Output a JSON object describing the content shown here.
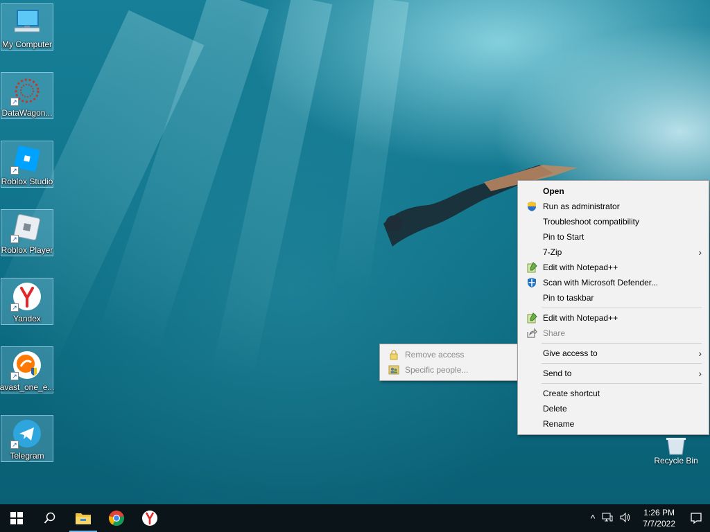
{
  "desktop": {
    "icons": [
      {
        "label": "My Computer",
        "icon": "computer-icon"
      },
      {
        "label": "DataWagon...",
        "icon": "datawagon-icon"
      },
      {
        "label": "Roblox Studio",
        "icon": "roblox-studio-icon"
      },
      {
        "label": "Roblox Player",
        "icon": "roblox-player-icon"
      },
      {
        "label": "Yandex",
        "icon": "yandex-icon"
      },
      {
        "label": "avast_one_e...",
        "icon": "avast-icon"
      },
      {
        "label": "Telegram",
        "icon": "telegram-icon"
      }
    ],
    "recycle_bin": {
      "label": "Recycle Bin",
      "icon": "recycle-bin-icon"
    }
  },
  "context_menu": {
    "items": [
      {
        "label": "Open"
      },
      {
        "label": "Run as administrator",
        "icon": "uac-shield-icon"
      },
      {
        "label": "Troubleshoot compatibility"
      },
      {
        "label": "Pin to Start"
      },
      {
        "label": "7-Zip",
        "submenu_arrow": "›"
      },
      {
        "label": "Edit with Notepad++",
        "icon": "notepad-plus-plus-icon"
      },
      {
        "label": "Scan with Microsoft Defender...",
        "icon": "defender-icon"
      },
      {
        "label": "Pin to taskbar"
      },
      {
        "label": "Edit with Notepad++",
        "icon": "notepad-plus-plus-icon"
      },
      {
        "label": "Share",
        "icon": "share-icon"
      },
      {
        "label": "Give access to",
        "submenu_arrow": "›"
      },
      {
        "label": "Send to",
        "submenu_arrow": "›"
      },
      {
        "label": "Create shortcut"
      },
      {
        "label": "Delete"
      },
      {
        "label": "Rename"
      }
    ]
  },
  "give_access_submenu": {
    "items": [
      {
        "label": "Remove access",
        "icon": "lock-icon"
      },
      {
        "label": "Specific people...",
        "icon": "people-icon"
      }
    ]
  },
  "taskbar": {
    "pinned": [
      "start-icon",
      "search-icon",
      "file-explorer-icon",
      "chrome-icon",
      "yandex-browser-icon"
    ],
    "tray": {
      "chevron": "^",
      "time": "1:26 PM",
      "date": "7/7/2022"
    }
  },
  "colors": {
    "menu_bg": "#f2f2f2",
    "taskbar_bg": "#0b1418",
    "accent": "#76b9ed"
  }
}
